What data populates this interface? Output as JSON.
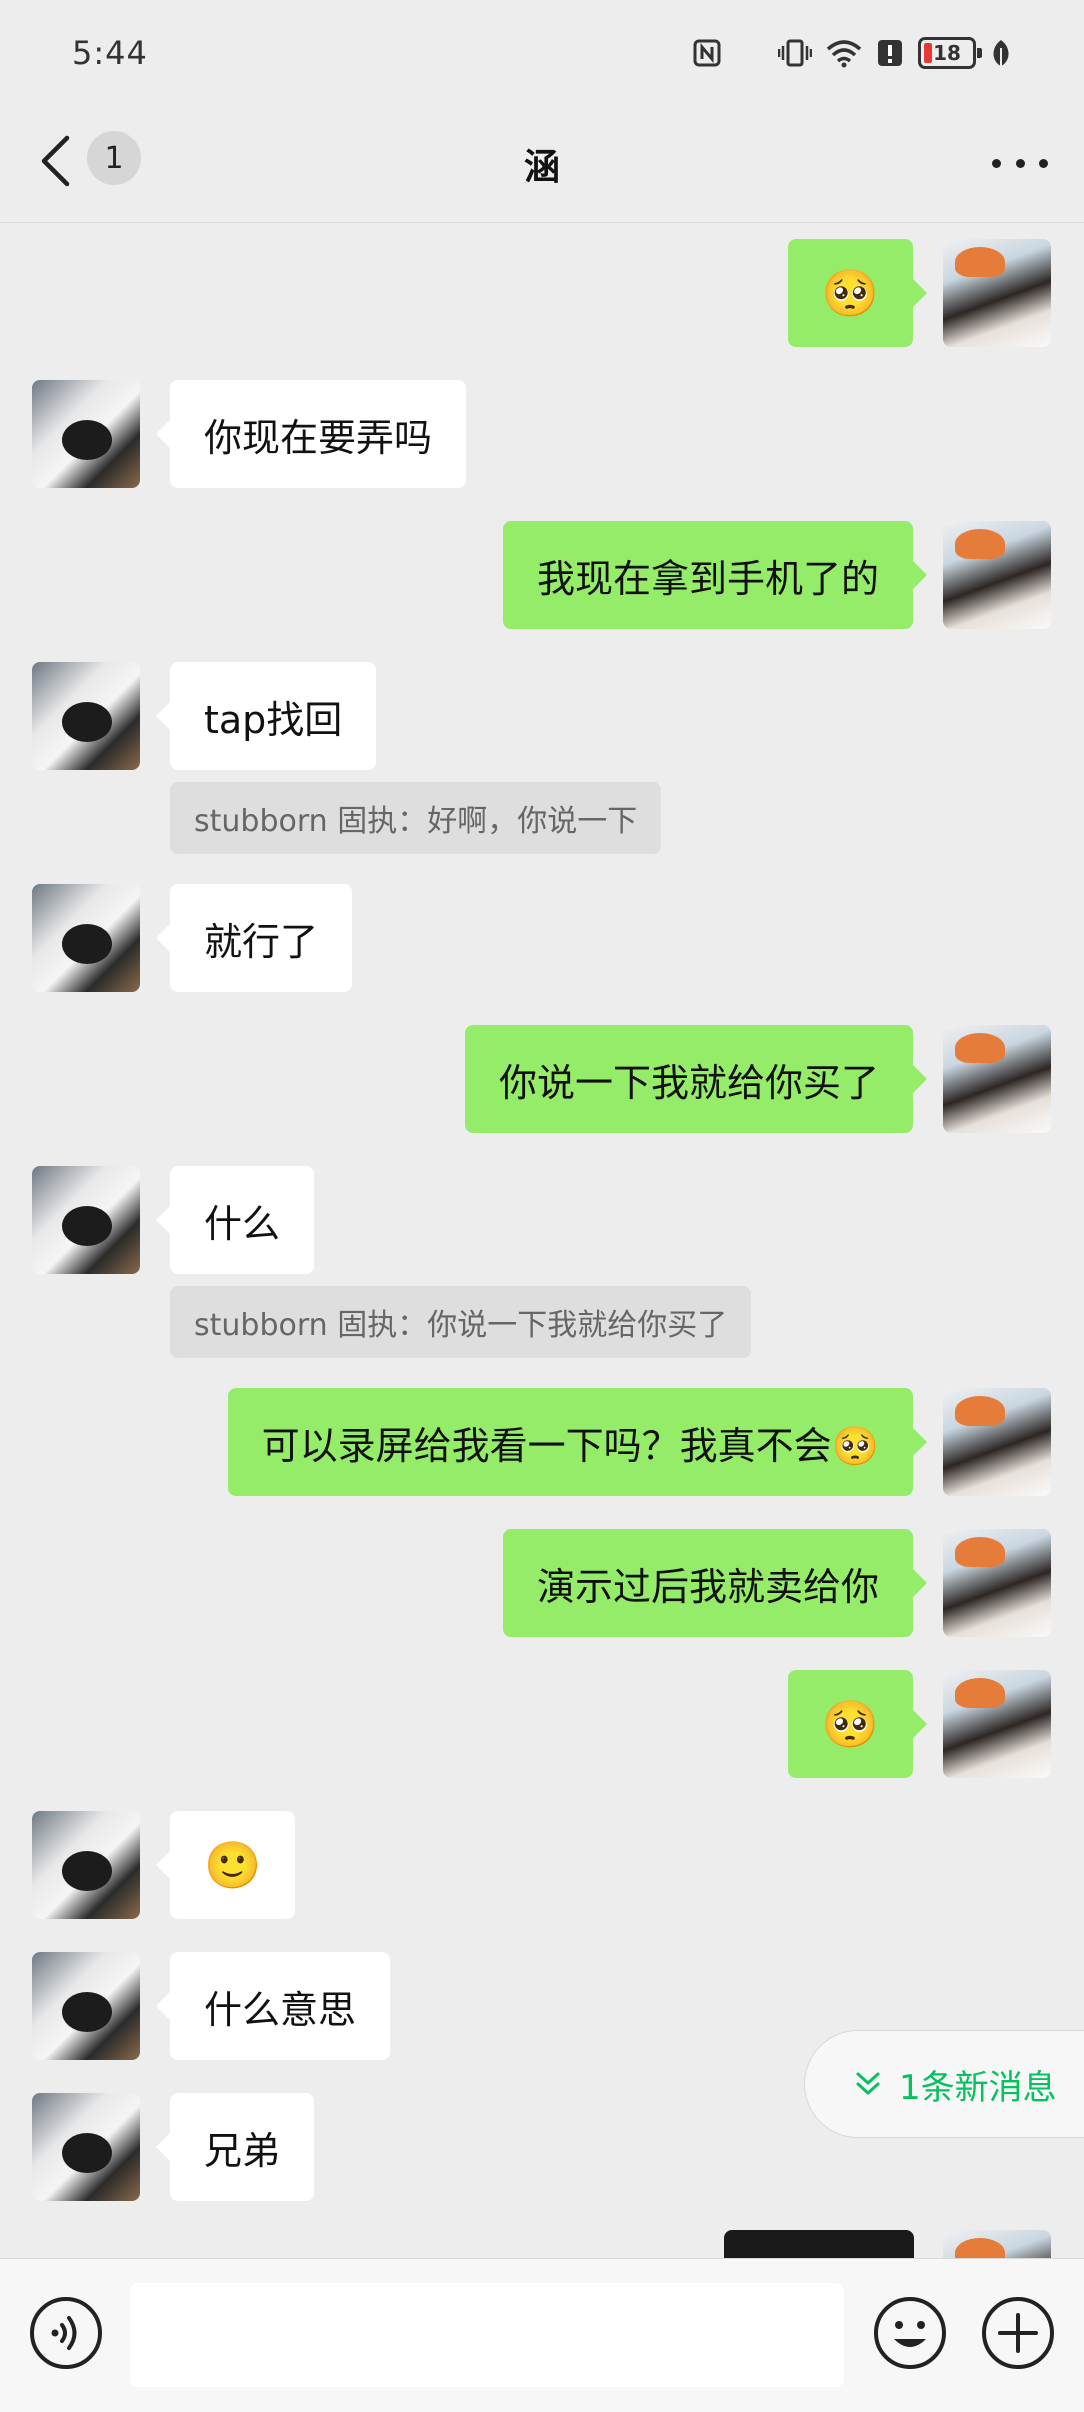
{
  "status_bar": {
    "time": "5:44",
    "battery_level": "18",
    "icons": [
      "nfc-icon",
      "moon-icon",
      "vibrate-icon",
      "wifi-icon",
      "alert-icon",
      "battery-icon",
      "leaf-icon"
    ]
  },
  "nav": {
    "back_icon": "chevron-left-icon",
    "unread_count": "1",
    "title": "涵",
    "more_icon": "more-dots-icon"
  },
  "messages": [
    {
      "side": "me",
      "type": "emoji",
      "text": "🥺"
    },
    {
      "side": "peer",
      "type": "text",
      "text": "你现在要弄吗"
    },
    {
      "side": "me",
      "type": "text",
      "text": "我现在拿到手机了的"
    },
    {
      "side": "peer",
      "type": "text",
      "text": "tap找回",
      "quote": "stubborn 固执：好啊，你说一下"
    },
    {
      "side": "peer",
      "type": "text",
      "text": "就行了"
    },
    {
      "side": "me",
      "type": "text",
      "text": "你说一下我就给你买了"
    },
    {
      "side": "peer",
      "type": "text",
      "text": "什么",
      "quote": "stubborn 固执：你说一下我就给你买了"
    },
    {
      "side": "me",
      "type": "text",
      "text": "可以录屏给我看一下吗？我真不会🥺"
    },
    {
      "side": "me",
      "type": "text",
      "text": "演示过后我就卖给你"
    },
    {
      "side": "me",
      "type": "emoji",
      "text": "🥺"
    },
    {
      "side": "peer",
      "type": "emoji",
      "text": "🙂"
    },
    {
      "side": "peer",
      "type": "text",
      "text": "什么意思"
    },
    {
      "side": "peer",
      "type": "text",
      "text": "兄弟"
    }
  ],
  "new_messages_pill": {
    "label": "1条新消息",
    "icon": "double-chevron-down-icon"
  },
  "input_bar": {
    "voice_icon": "voice-icon",
    "input_value": "",
    "emoji_icon": "emoji-icon",
    "plus_icon": "plus-icon"
  },
  "colors": {
    "background": "#ededed",
    "my_bubble": "#95ec69",
    "peer_bubble": "#ffffff",
    "quote_bg": "#dedede",
    "accent_green": "#07c160"
  }
}
